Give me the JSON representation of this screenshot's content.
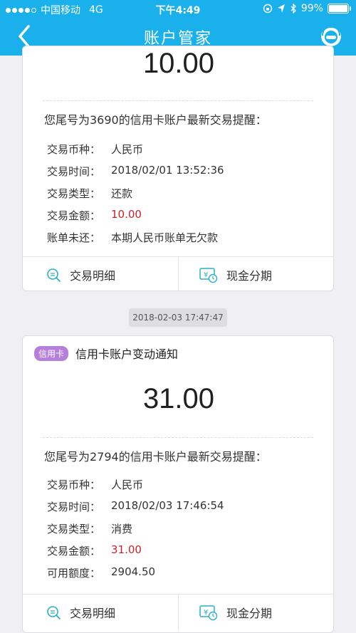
{
  "status_bar": {
    "carrier": "中国移动",
    "network": "4G",
    "time": "下午4:49",
    "battery_text": "99%",
    "battery_level": 0.99,
    "signal_bars_filled": 4
  },
  "nav": {
    "title": "账户管家",
    "back_icon": "chevron-left-icon",
    "service_icon": "customer-service-icon"
  },
  "cards": [
    {
      "amount": "10.00",
      "description": "您尾号为3690的信用卡账户最新交易提醒：",
      "rows": [
        {
          "label": "交易币种：",
          "value": "人民币"
        },
        {
          "label": "交易时间：",
          "value": "2018/02/01 13:52:36"
        },
        {
          "label": "交易类型：",
          "value": "还款"
        },
        {
          "label": "交易金额：",
          "value": "10.00"
        },
        {
          "label": "账单未还：",
          "value": "本期人民币账单无欠款"
        }
      ],
      "actions": {
        "detail": "交易明细",
        "installment": "现金分期"
      }
    },
    {
      "timestamp": "2018-02-03 17:47:47",
      "badge": "信用卡",
      "title": "信用卡账户变动通知",
      "amount": "31.00",
      "description": "您尾号为2794的信用卡账户最新交易提醒：",
      "rows": [
        {
          "label": "交易币种：",
          "value": "人民币"
        },
        {
          "label": "交易时间：",
          "value": "2018/02/03 17:46:54"
        },
        {
          "label": "交易类型：",
          "value": "消费"
        },
        {
          "label": "交易金额：",
          "value": "31.00"
        },
        {
          "label": "可用额度：",
          "value": "2904.50"
        }
      ],
      "actions": {
        "detail": "交易明细",
        "installment": "现金分期"
      }
    }
  ],
  "colors": {
    "accent": "#19b0ec",
    "amount_red": "#c8232c",
    "badge": "#b57fda",
    "icon_teal": "#2bb0c7"
  }
}
